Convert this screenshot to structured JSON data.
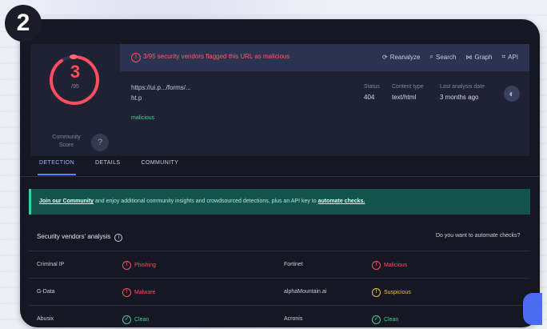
{
  "step_badge": "2",
  "score": {
    "value": "3",
    "sublabel": "/95",
    "community_label": "Community Score",
    "community_icon": "?"
  },
  "alert": {
    "text": "3/95 security vendors flagged this URL as malicious",
    "actions": [
      {
        "icon": "refresh-icon",
        "glyph": "⟳",
        "label": "Reanalyze"
      },
      {
        "icon": "search-icon",
        "glyph": "⌕",
        "label": "Search"
      },
      {
        "icon": "graph-icon",
        "glyph": "⋈",
        "label": "Graph"
      },
      {
        "icon": "api-icon",
        "glyph": "⌗",
        "label": "API"
      }
    ]
  },
  "url": {
    "line1": "https://ui.p.../forms/...",
    "line2": "ht.p",
    "tag": "malicious"
  },
  "meta": [
    {
      "label": "Status",
      "value": "404"
    },
    {
      "label": "Content type",
      "value": "text/html"
    },
    {
      "label": "Last analysis date",
      "value": "3 months ago"
    }
  ],
  "globe_glyph": "◐",
  "tabs": [
    {
      "label": "DETECTION",
      "active": true
    },
    {
      "label": "DETAILS",
      "active": false
    },
    {
      "label": "COMMUNITY",
      "active": false
    }
  ],
  "banner": {
    "link_start": "Join our Community",
    "text_mid": " and enjoy additional community insights and crowdsourced detections, plus an API key to ",
    "link_end": "automate checks."
  },
  "analysis": {
    "title": "Security vendors' analysis",
    "help": "Do you want to automate checks?",
    "rows": [
      {
        "left_name": "Criminal IP",
        "left_result": "Phishing",
        "left_status": "bad",
        "right_name": "Fortinet",
        "right_result": "Malicious",
        "right_status": "bad"
      },
      {
        "left_name": "G-Data",
        "left_result": "Malware",
        "left_status": "bad",
        "right_name": "alphaMountain.ai",
        "right_result": "Suspicious",
        "right_status": "warn"
      },
      {
        "left_name": "Abusix",
        "left_result": "Clean",
        "left_status": "good",
        "right_name": "Acronis",
        "right_result": "Clean",
        "right_status": "good"
      }
    ]
  },
  "colors": {
    "bad": "#ff4d5e",
    "warn": "#e8c547",
    "good": "#3fcf95"
  }
}
